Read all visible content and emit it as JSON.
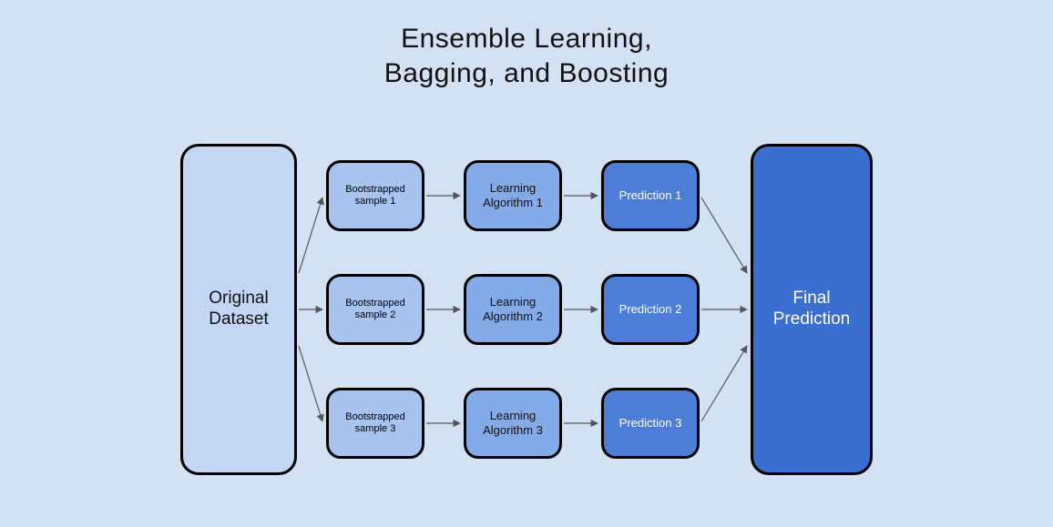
{
  "title_line1": "Ensemble Learning,",
  "title_line2": "Bagging, and Boosting",
  "nodes": {
    "original": "Original\nDataset",
    "bs1": "Bootstrapped\nsample 1",
    "bs2": "Bootstrapped\nsample 2",
    "bs3": "Bootstrapped\nsample 3",
    "la1": "Learning\nAlgorithm 1",
    "la2": "Learning\nAlgorithm 2",
    "la3": "Learning\nAlgorithm 3",
    "p1": "Prediction 1",
    "p2": "Prediction 2",
    "p3": "Prediction 3",
    "final": "Final\nPrediction"
  }
}
